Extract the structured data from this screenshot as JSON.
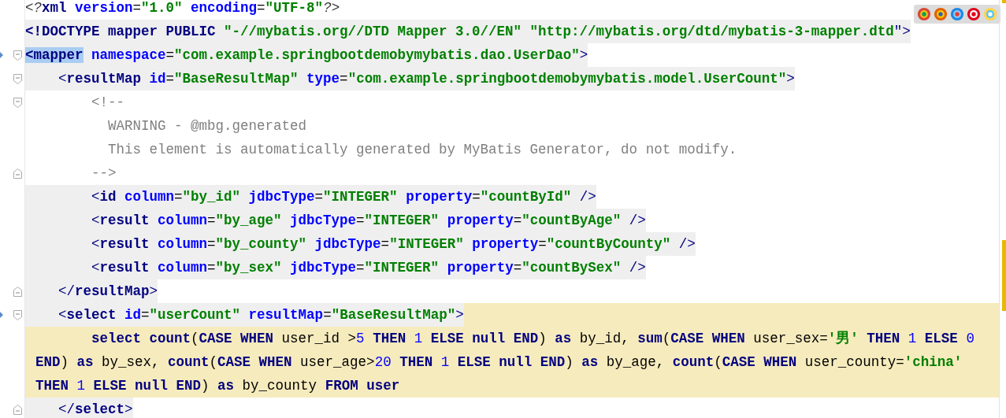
{
  "editor": {
    "lines": [
      {
        "fold_start": false,
        "fold_end": false,
        "marker": false,
        "tag_bg": false,
        "highlight": false,
        "continuation": false,
        "tokens": [
          {
            "kind": "pi",
            "text": "<?"
          },
          {
            "kind": "tag",
            "text": "xml"
          },
          {
            "kind": "attr",
            "text": " version"
          },
          {
            "kind": "plain",
            "text": "="
          },
          {
            "kind": "value",
            "text": "\"1.0\""
          },
          {
            "kind": "attr",
            "text": " encoding"
          },
          {
            "kind": "plain",
            "text": "="
          },
          {
            "kind": "value",
            "text": "\"UTF-8\""
          },
          {
            "kind": "pi",
            "text": "?>"
          }
        ]
      },
      {
        "fold_start": false,
        "fold_end": false,
        "marker": false,
        "tag_bg": true,
        "highlight": false,
        "continuation": false,
        "tokens": [
          {
            "kind": "tag",
            "text": "<!DOCTYPE mapper PUBLIC "
          },
          {
            "kind": "value",
            "text": "\"-//mybatis.org//DTD Mapper 3.0//EN\" \"http://mybatis.org/dtd/mybatis-3-mapper.dtd"
          },
          {
            "kind": "bracket",
            "text": "\">"
          }
        ]
      },
      {
        "fold_start": true,
        "fold_end": false,
        "marker": true,
        "tag_bg": true,
        "highlight": false,
        "continuation": false,
        "tokens": [
          {
            "kind": "match",
            "text": "<mapper"
          },
          {
            "kind": "attr",
            "text": " namespace"
          },
          {
            "kind": "plain",
            "text": "="
          },
          {
            "kind": "value",
            "text": "\"com.example.springbootdemobymybatis.dao.UserDao\""
          },
          {
            "kind": "bracket",
            "text": ">"
          }
        ]
      },
      {
        "fold_start": true,
        "fold_end": false,
        "marker": false,
        "tag_bg": true,
        "highlight": false,
        "continuation": false,
        "tokens": [
          {
            "kind": "bracket",
            "text": "    <"
          },
          {
            "kind": "tag",
            "text": "resultMap"
          },
          {
            "kind": "attr",
            "text": " id"
          },
          {
            "kind": "plain",
            "text": "="
          },
          {
            "kind": "value",
            "text": "\"BaseResultMap\""
          },
          {
            "kind": "attr",
            "text": " type"
          },
          {
            "kind": "plain",
            "text": "="
          },
          {
            "kind": "value",
            "text": "\"com.example.springbootdemobymybatis.model.UserCount\""
          },
          {
            "kind": "bracket",
            "text": ">"
          }
        ]
      },
      {
        "fold_start": true,
        "fold_end": false,
        "marker": false,
        "tag_bg": false,
        "highlight": false,
        "continuation": false,
        "tokens": [
          {
            "kind": "comment",
            "text": "        <!--"
          }
        ]
      },
      {
        "fold_start": false,
        "fold_end": false,
        "marker": false,
        "tag_bg": false,
        "highlight": false,
        "continuation": false,
        "tokens": [
          {
            "kind": "comment",
            "text": "          WARNING - @mbg.generated"
          }
        ]
      },
      {
        "fold_start": false,
        "fold_end": false,
        "marker": false,
        "tag_bg": false,
        "highlight": false,
        "continuation": false,
        "tokens": [
          {
            "kind": "comment",
            "text": "          This element is automatically generated by MyBatis Generator, do not modify."
          }
        ]
      },
      {
        "fold_start": false,
        "fold_end": true,
        "marker": false,
        "tag_bg": false,
        "highlight": false,
        "continuation": false,
        "tokens": [
          {
            "kind": "comment",
            "text": "        -->"
          }
        ]
      },
      {
        "fold_start": false,
        "fold_end": false,
        "marker": false,
        "tag_bg": true,
        "highlight": false,
        "continuation": false,
        "tokens": [
          {
            "kind": "bracket",
            "text": "        <"
          },
          {
            "kind": "tag",
            "text": "id"
          },
          {
            "kind": "attr",
            "text": " column"
          },
          {
            "kind": "plain",
            "text": "="
          },
          {
            "kind": "value",
            "text": "\"by_id\""
          },
          {
            "kind": "attr",
            "text": " jdbcType"
          },
          {
            "kind": "plain",
            "text": "="
          },
          {
            "kind": "value",
            "text": "\"INTEGER\""
          },
          {
            "kind": "attr",
            "text": " property"
          },
          {
            "kind": "plain",
            "text": "="
          },
          {
            "kind": "value",
            "text": "\"countById\""
          },
          {
            "kind": "bracket",
            "text": " />"
          }
        ]
      },
      {
        "fold_start": false,
        "fold_end": false,
        "marker": false,
        "tag_bg": true,
        "highlight": false,
        "continuation": false,
        "tokens": [
          {
            "kind": "bracket",
            "text": "        <"
          },
          {
            "kind": "tag",
            "text": "result"
          },
          {
            "kind": "attr",
            "text": " column"
          },
          {
            "kind": "plain",
            "text": "="
          },
          {
            "kind": "value",
            "text": "\"by_age\""
          },
          {
            "kind": "attr",
            "text": " jdbcType"
          },
          {
            "kind": "plain",
            "text": "="
          },
          {
            "kind": "value",
            "text": "\"INTEGER\""
          },
          {
            "kind": "attr",
            "text": " property"
          },
          {
            "kind": "plain",
            "text": "="
          },
          {
            "kind": "value",
            "text": "\"countByAge\""
          },
          {
            "kind": "bracket",
            "text": " />"
          }
        ]
      },
      {
        "fold_start": false,
        "fold_end": false,
        "marker": false,
        "tag_bg": true,
        "highlight": false,
        "continuation": false,
        "tokens": [
          {
            "kind": "bracket",
            "text": "        <"
          },
          {
            "kind": "tag",
            "text": "result"
          },
          {
            "kind": "attr",
            "text": " column"
          },
          {
            "kind": "plain",
            "text": "="
          },
          {
            "kind": "value",
            "text": "\"by_county\""
          },
          {
            "kind": "attr",
            "text": " jdbcType"
          },
          {
            "kind": "plain",
            "text": "="
          },
          {
            "kind": "value",
            "text": "\"INTEGER\""
          },
          {
            "kind": "attr",
            "text": " property"
          },
          {
            "kind": "plain",
            "text": "="
          },
          {
            "kind": "value",
            "text": "\"countByCounty\""
          },
          {
            "kind": "bracket",
            "text": " />"
          }
        ]
      },
      {
        "fold_start": false,
        "fold_end": false,
        "marker": false,
        "tag_bg": true,
        "highlight": false,
        "continuation": false,
        "tokens": [
          {
            "kind": "bracket",
            "text": "        <"
          },
          {
            "kind": "tag",
            "text": "result"
          },
          {
            "kind": "attr",
            "text": " column"
          },
          {
            "kind": "plain",
            "text": "="
          },
          {
            "kind": "value",
            "text": "\"by_sex\""
          },
          {
            "kind": "attr",
            "text": " jdbcType"
          },
          {
            "kind": "plain",
            "text": "="
          },
          {
            "kind": "value",
            "text": "\"INTEGER\""
          },
          {
            "kind": "attr",
            "text": " property"
          },
          {
            "kind": "plain",
            "text": "="
          },
          {
            "kind": "value",
            "text": "\"countBySex\""
          },
          {
            "kind": "bracket",
            "text": " />"
          }
        ]
      },
      {
        "fold_start": false,
        "fold_end": true,
        "marker": false,
        "tag_bg": true,
        "highlight": false,
        "continuation": false,
        "tokens": [
          {
            "kind": "bracket",
            "text": "    </"
          },
          {
            "kind": "tag",
            "text": "resultMap"
          },
          {
            "kind": "bracket",
            "text": ">"
          }
        ]
      },
      {
        "fold_start": true,
        "fold_end": false,
        "marker": true,
        "tag_bg": true,
        "highlight": true,
        "continuation": false,
        "tokens": [
          {
            "kind": "bracket",
            "text": "    <"
          },
          {
            "kind": "tag",
            "text": "select"
          },
          {
            "kind": "attr",
            "text": " id"
          },
          {
            "kind": "plain",
            "text": "="
          },
          {
            "kind": "value",
            "text": "\"userCount\""
          },
          {
            "kind": "attr",
            "text": " resultMap"
          },
          {
            "kind": "plain",
            "text": "="
          },
          {
            "kind": "value",
            "text": "\"BaseResultMap\""
          },
          {
            "kind": "bracket",
            "text": ">"
          }
        ]
      },
      {
        "fold_start": false,
        "fold_end": false,
        "marker": false,
        "tag_bg": false,
        "highlight": true,
        "continuation": false,
        "tokens": [
          {
            "kind": "keyword",
            "text": "        select count"
          },
          {
            "kind": "plain",
            "text": "("
          },
          {
            "kind": "keyword",
            "text": "CASE WHEN"
          },
          {
            "kind": "plain",
            "text": " user_id >"
          },
          {
            "kind": "number",
            "text": "5"
          },
          {
            "kind": "keyword",
            "text": " THEN"
          },
          {
            "kind": "number",
            "text": " 1"
          },
          {
            "kind": "keyword",
            "text": " ELSE null END"
          },
          {
            "kind": "plain",
            "text": ") "
          },
          {
            "kind": "keyword",
            "text": "as"
          },
          {
            "kind": "plain",
            "text": " by_id, "
          },
          {
            "kind": "keyword",
            "text": "sum"
          },
          {
            "kind": "plain",
            "text": "("
          },
          {
            "kind": "keyword",
            "text": "CASE WHEN"
          },
          {
            "kind": "plain",
            "text": " user_sex="
          },
          {
            "kind": "string",
            "text": "'男'"
          },
          {
            "kind": "keyword",
            "text": " THEN"
          },
          {
            "kind": "number",
            "text": " 1"
          },
          {
            "kind": "keyword",
            "text": " ELSE"
          },
          {
            "kind": "number",
            "text": " 0"
          }
        ]
      },
      {
        "fold_start": false,
        "fold_end": false,
        "marker": false,
        "tag_bg": false,
        "highlight": true,
        "continuation": true,
        "tokens": [
          {
            "kind": "keyword",
            "text": "END"
          },
          {
            "kind": "plain",
            "text": ") "
          },
          {
            "kind": "keyword",
            "text": "as"
          },
          {
            "kind": "plain",
            "text": " by_sex, "
          },
          {
            "kind": "keyword",
            "text": "count"
          },
          {
            "kind": "plain",
            "text": "("
          },
          {
            "kind": "keyword",
            "text": "CASE WHEN"
          },
          {
            "kind": "plain",
            "text": " user_age>"
          },
          {
            "kind": "number",
            "text": "20"
          },
          {
            "kind": "keyword",
            "text": " THEN"
          },
          {
            "kind": "number",
            "text": " 1"
          },
          {
            "kind": "keyword",
            "text": " ELSE null END"
          },
          {
            "kind": "plain",
            "text": ") "
          },
          {
            "kind": "keyword",
            "text": "as"
          },
          {
            "kind": "plain",
            "text": " by_age, "
          },
          {
            "kind": "keyword",
            "text": "count"
          },
          {
            "kind": "plain",
            "text": "("
          },
          {
            "kind": "keyword",
            "text": "CASE WHEN"
          },
          {
            "kind": "plain",
            "text": " user_county="
          },
          {
            "kind": "string",
            "text": "'china'"
          }
        ]
      },
      {
        "fold_start": false,
        "fold_end": false,
        "marker": false,
        "tag_bg": false,
        "highlight": true,
        "continuation": true,
        "tokens": [
          {
            "kind": "keyword",
            "text": "THEN"
          },
          {
            "kind": "number",
            "text": " 1"
          },
          {
            "kind": "keyword",
            "text": " ELSE null END"
          },
          {
            "kind": "plain",
            "text": ") "
          },
          {
            "kind": "keyword",
            "text": "as"
          },
          {
            "kind": "plain",
            "text": " by_county "
          },
          {
            "kind": "keyword",
            "text": "FROM user"
          }
        ]
      },
      {
        "fold_start": false,
        "fold_end": true,
        "marker": false,
        "tag_bg": true,
        "highlight": false,
        "continuation": false,
        "tokens": [
          {
            "kind": "bracket",
            "text": "    </"
          },
          {
            "kind": "tag",
            "text": "select"
          },
          {
            "kind": "bracket",
            "text": ">"
          }
        ]
      }
    ]
  }
}
